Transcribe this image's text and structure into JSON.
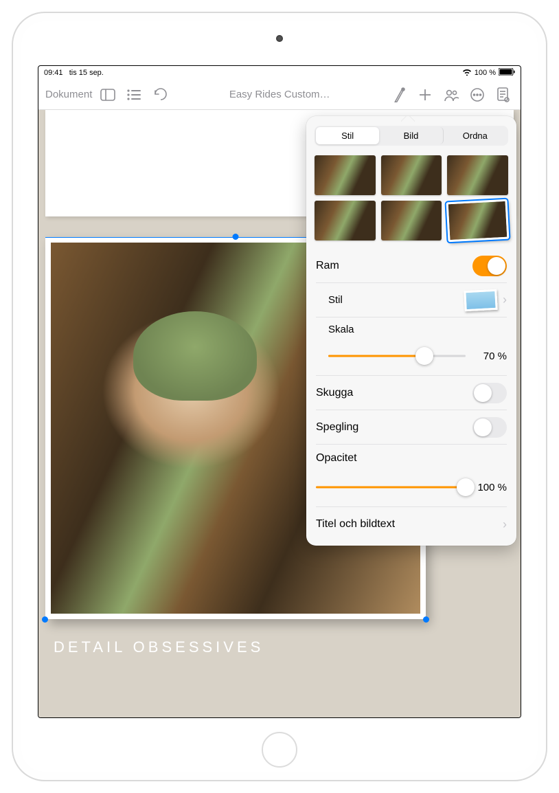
{
  "status": {
    "time": "09:41",
    "date": "tis 15 sep.",
    "battery": "100 %"
  },
  "toolbar": {
    "back_label": "Dokument",
    "title": "Easy Rides Custom…"
  },
  "canvas": {
    "photo_caption": "DETAIL OBSESSIVES"
  },
  "popover": {
    "tabs": {
      "style": "Stil",
      "image": "Bild",
      "arrange": "Ordna"
    },
    "frame": {
      "label": "Ram",
      "on": true
    },
    "style": {
      "label": "Stil"
    },
    "scale": {
      "label": "Skala",
      "value": 70,
      "display": "70 %"
    },
    "shadow": {
      "label": "Skugga",
      "on": false
    },
    "reflection": {
      "label": "Spegling",
      "on": false
    },
    "opacity": {
      "label": "Opacitet",
      "value": 100,
      "display": "100 %"
    },
    "caption": {
      "label": "Titel och bildtext"
    }
  },
  "colors": {
    "accent": "#ff9500"
  }
}
